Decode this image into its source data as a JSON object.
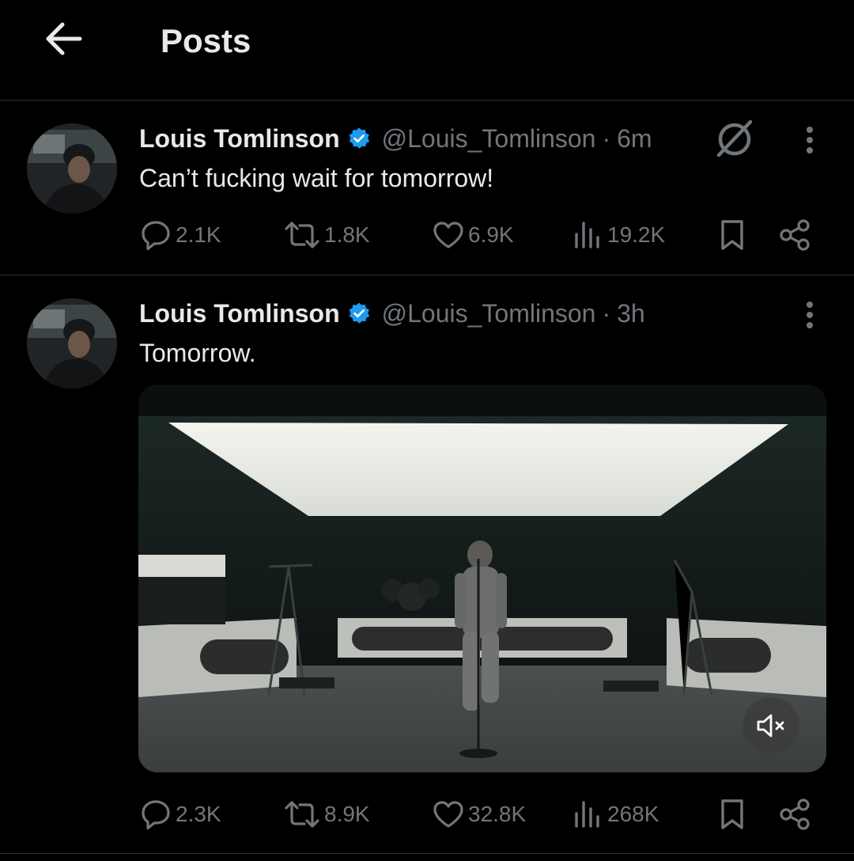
{
  "header": {
    "title": "Posts",
    "back_icon": "arrow-left-icon"
  },
  "posts": [
    {
      "author": {
        "name": "Louis Tomlinson",
        "handle": "@Louis_Tomlinson",
        "verified": true
      },
      "separator": "·",
      "time": "6m",
      "text": "Can’t fucking wait for tomorrow!",
      "stats": {
        "replies": "2.1K",
        "reposts": "1.8K",
        "likes": "6.9K",
        "views": "19.2K"
      }
    },
    {
      "author": {
        "name": "Louis Tomlinson",
        "handle": "@Louis_Tomlinson",
        "verified": true
      },
      "separator": "·",
      "time": "3h",
      "text": "Tomorrow.",
      "media": {
        "type": "video",
        "muted": true
      },
      "stats": {
        "replies": "2.3K",
        "reposts": "8.9K",
        "likes": "32.8K",
        "views": "268K"
      }
    }
  ],
  "colors": {
    "background": "#000000",
    "text": "#e7e9ea",
    "secondary": "#71767b",
    "verified": "#1d9bf0",
    "divider": "#2f3336"
  }
}
